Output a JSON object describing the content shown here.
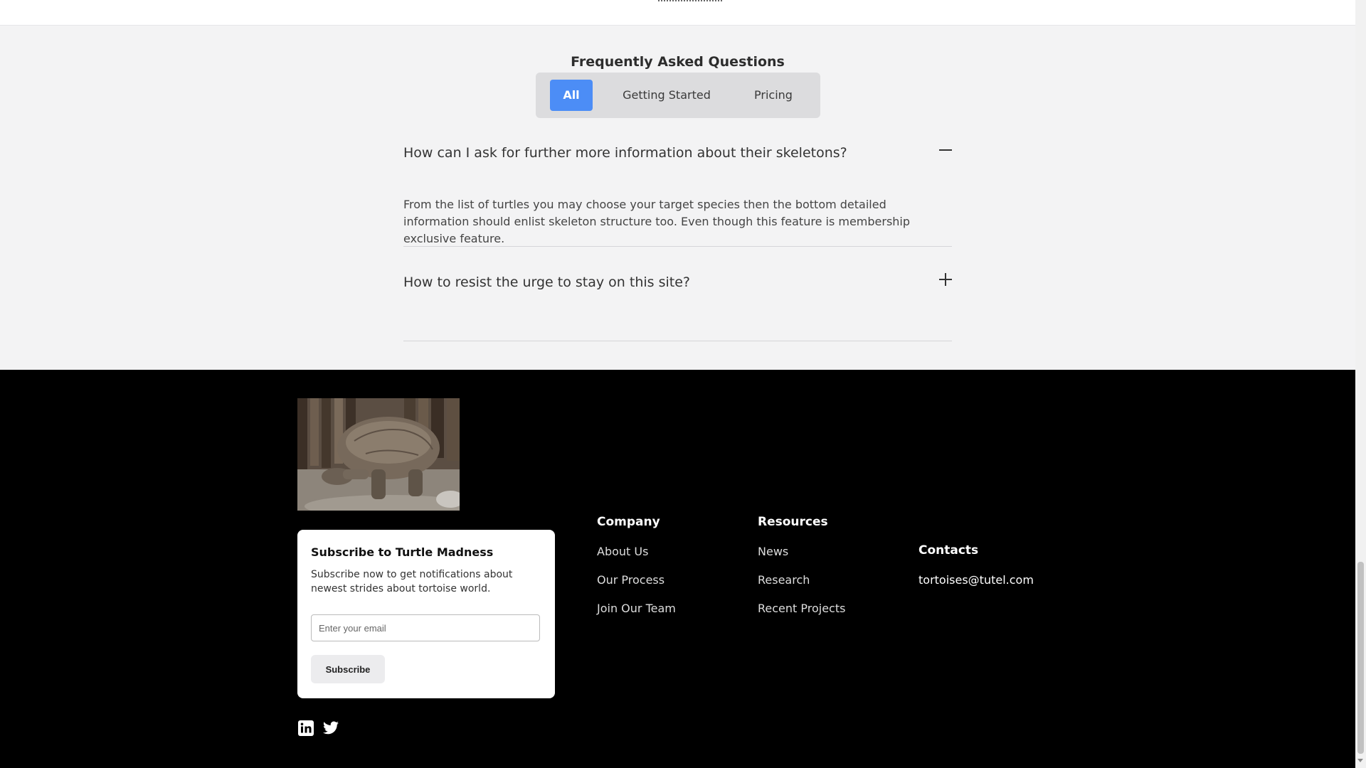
{
  "faq": {
    "title": "Frequently Asked Questions",
    "tabs": [
      {
        "label": "All",
        "active": true
      },
      {
        "label": "Getting Started",
        "active": false
      },
      {
        "label": "Pricing",
        "active": false
      }
    ],
    "items": [
      {
        "question": "How can I ask for further more information about their skeletons?",
        "answer": "From the list of turtles you may choose your target species then the bottom detailed information should enlist skeleton structure too. Even though this feature is membership exclusive feature.",
        "expanded": true
      },
      {
        "question": "How to resist the urge to stay on this site?",
        "expanded": false
      }
    ]
  },
  "footer": {
    "subscribe": {
      "title": "Subscribe to Turtle Madness",
      "text": "Subscribe now to get notifications about newest strides about tortoise world.",
      "email_placeholder": "Enter your email",
      "button_label": "Subscribe"
    },
    "company": {
      "heading": "Company",
      "links": [
        "About Us",
        "Our Process",
        "Join Our Team"
      ]
    },
    "resources": {
      "heading": "Resources",
      "links": [
        "News",
        "Research",
        "Recent Projects"
      ]
    },
    "contacts": {
      "heading": "Contacts",
      "email": "tortoises@tutel.com"
    },
    "social_icons": [
      "linkedin-icon",
      "twitter-icon"
    ]
  },
  "colors": {
    "accent": "#4c8df6",
    "faq_background": "#f3f3f4",
    "footer_background": "#000000"
  }
}
